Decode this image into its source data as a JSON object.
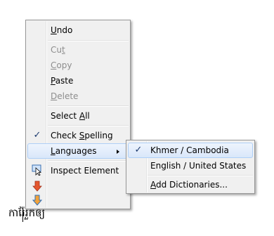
{
  "context_menu": {
    "items": [
      {
        "label": "Undo",
        "mnemonic": "U",
        "rest": "ndo"
      },
      {
        "label": "Cut",
        "before": "Cu",
        "mnemonic": "t",
        "rest": ""
      },
      {
        "label": "Copy",
        "mnemonic": "C",
        "rest": "opy"
      },
      {
        "label": "Paste",
        "mnemonic": "P",
        "rest": "aste"
      },
      {
        "label": "Delete",
        "mnemonic": "D",
        "rest": "elete"
      },
      {
        "label": "Select All",
        "before": "Select ",
        "mnemonic": "A",
        "rest": "ll"
      },
      {
        "label": "Check Spelling",
        "before": "Check ",
        "mnemonic": "S",
        "rest": "pelling"
      },
      {
        "label": "Languages",
        "mnemonic": "L",
        "rest": "anguages"
      },
      {
        "label": "Inspect Element"
      }
    ],
    "check_mark": "✓"
  },
  "languages_submenu": {
    "items": [
      {
        "label": "Khmer / Cambodia"
      },
      {
        "label": "English / United States"
      },
      {
        "label": "Add Dictionaries...",
        "mnemonic": "A",
        "rest": "dd Dictionaries..."
      }
    ],
    "check_mark": "✓"
  },
  "editor": {
    "text": "ការ៉ែរួកឲ្យ"
  },
  "colors": {
    "highlight_border": "#aecff7",
    "check_color": "#1c3a6e",
    "disabled_text": "#8d8d8d"
  }
}
